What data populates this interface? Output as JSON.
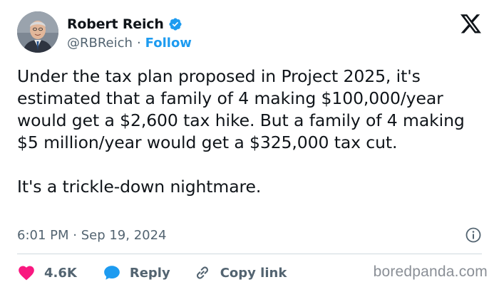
{
  "author": {
    "name": "Robert Reich",
    "handle": "@RBReich",
    "separator": "·",
    "follow_label": "Follow",
    "verified_color": "#1d9bf0"
  },
  "tweet": {
    "paragraph_1": "Under the tax plan proposed in Project 2025, it's estimated that a family of 4 making $100,000/year would get a $2,600 tax hike. But a family of 4 making $5 million/year would get a $325,000 tax cut.",
    "paragraph_2": "It's a trickle-down nightmare.",
    "timestamp": "6:01 PM · Sep 19, 2024"
  },
  "actions": {
    "like_count": "4.6K",
    "reply_label": "Reply",
    "copy_link_label": "Copy link",
    "like_color": "#f91880",
    "reply_color": "#1d9bf0"
  },
  "watermark": "boredpanda.com",
  "icons": [
    "verified-badge-icon",
    "x-logo-icon",
    "info-icon",
    "heart-icon",
    "reply-bubble-icon",
    "link-icon"
  ]
}
